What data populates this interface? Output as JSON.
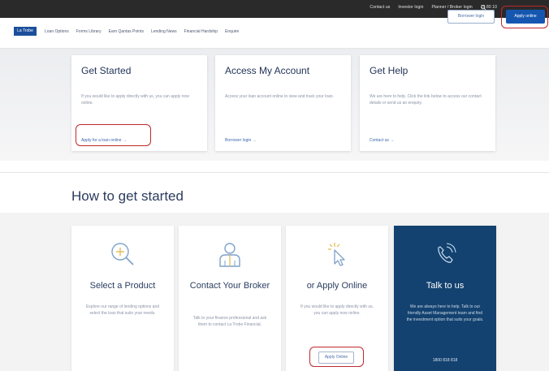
{
  "topbar": {
    "links": [
      "Contact us",
      "Investor login",
      "Planner / Broker login",
      "13 80 10"
    ]
  },
  "nav": {
    "logo_text": "La Trobe",
    "links": [
      "Loan Options",
      "Forms Library",
      "Earn Qantas Points",
      "Lending News",
      "Financial Hardship",
      "Enquire"
    ],
    "borrower_login": "Borrower login",
    "apply_online": "Apply online"
  },
  "hero": {
    "cards": [
      {
        "title": "Get Started",
        "desc": "If you would like to apply directly with us, you can apply now online.",
        "link": "Apply for a loan online →"
      },
      {
        "title": "Access My Account",
        "desc": "Access your loan account online to view and track your loan.",
        "link": "Borrower login →"
      },
      {
        "title": "Get Help",
        "desc": "We are here to help. Click the link below to access our contact details or send us an enquiry.",
        "link": "Contact us →"
      }
    ]
  },
  "how": {
    "title": "How to get started",
    "tiles": [
      {
        "title": "Select a Product",
        "desc": "Explore our range of lending options and select the loan that suits your needs.",
        "icon": "magnifier-plus-icon"
      },
      {
        "title": "Contact Your Broker",
        "desc": "Talk to your finance professional and ask them to contact La Trobe Financial.",
        "icon": "person-icon"
      },
      {
        "title": "or Apply Online",
        "desc": "If you would like to apply directly with us, you can apply now online.",
        "button": "Apply Online",
        "icon": "cursor-click-icon"
      },
      {
        "title": "Talk to us",
        "desc": "We are always here to help. Talk to our friendly Asset Management team and find the investment option that suits your goals.",
        "phone": "1800 818 818",
        "icon": "phone-icon"
      }
    ]
  },
  "colors": {
    "brand_blue": "#1557b0",
    "dark_tile": "#134270",
    "highlight": "#c0282d"
  }
}
